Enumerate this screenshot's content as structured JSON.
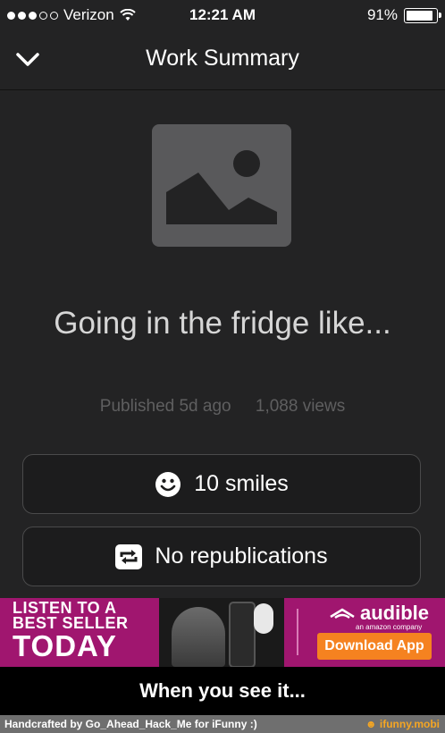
{
  "status_bar": {
    "carrier": "Verizon",
    "time": "12:21 AM",
    "battery": "91%",
    "battery_level": 0.91,
    "signal_bars_filled": 3,
    "signal_bars_total": 5
  },
  "nav": {
    "title": "Work Summary",
    "back_icon": "chevron-down-icon"
  },
  "post": {
    "caption": "Going in the fridge like...",
    "published": "Published 5d ago",
    "views": "1,088 views"
  },
  "actions": {
    "smiles_label": "10 smiles",
    "republications_label": "No republications"
  },
  "ad": {
    "line1": "LISTEN TO A",
    "line2": "BEST SELLER",
    "line3": "TODAY",
    "brand": "audible",
    "brand_sub": "an amazon company",
    "cta": "Download App"
  },
  "bottom_caption": "When you see it...",
  "footer": {
    "credit": "Handcrafted by Go_Ahead_Hack_Me for iFunny :)",
    "site": "ifunny.mobi"
  },
  "colors": {
    "background": "#232324",
    "ad_background": "#a0166f",
    "cta": "#f58220",
    "site_link": "#f5a623"
  }
}
